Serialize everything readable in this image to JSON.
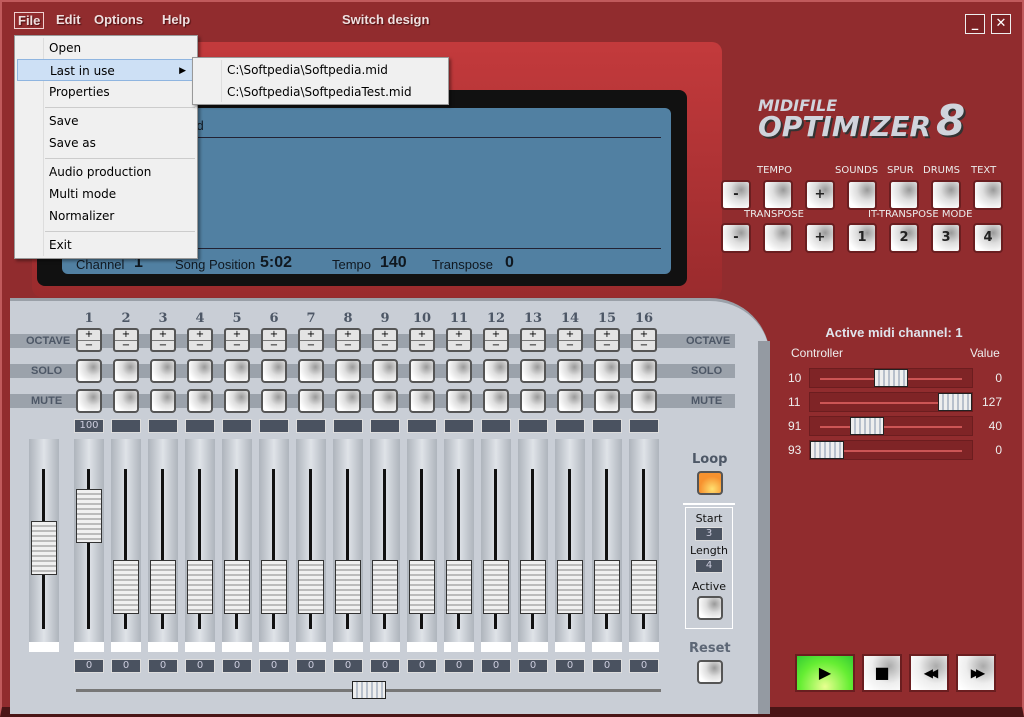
{
  "menu": {
    "file": "File",
    "edit": "Edit",
    "options": "Options",
    "help": "Help",
    "switch_design": "Switch design"
  },
  "window": {
    "minimize": "_",
    "close": "✕"
  },
  "file_menu": {
    "open": "Open",
    "last_in_use": "Last in use",
    "properties": "Properties",
    "save": "Save",
    "save_as": "Save as",
    "audio_production": "Audio production",
    "multi_mode": "Multi mode",
    "normalizer": "Normalizer",
    "exit": "Exit"
  },
  "recent_files": [
    "C:\\Softpedia\\Softpedia.mid",
    "C:\\Softpedia\\SoftpediaTest.mid"
  ],
  "display": {
    "filename": "a.mid",
    "channel_label": "Channel",
    "channel": "1",
    "song_position_label": "Song Position",
    "song_position": "5:02",
    "tempo_label": "Tempo",
    "tempo": "140",
    "transpose_label": "Transpose",
    "transpose": "0"
  },
  "logo": {
    "line1": "MIDIFILE",
    "line2": "OPTIMIZER",
    "version": "8"
  },
  "controls": {
    "tempo": "TEMPO",
    "sounds": "SOUNDS",
    "spur": "SPUR",
    "drums": "DRUMS",
    "text": "TEXT",
    "transpose": "TRANSPOSE",
    "it_transpose_mode": "IT-TRANSPOSE MODE",
    "minus": "-",
    "plus": "+",
    "modes": [
      "1",
      "2",
      "3",
      "4"
    ]
  },
  "mixer": {
    "octave": "OCTAVE",
    "solo": "SOLO",
    "mute": "MUTE",
    "plus": "+",
    "minus": "−",
    "channels": [
      {
        "n": "1",
        "top": "100",
        "bottom": "0",
        "level": 0.85
      },
      {
        "n": "2",
        "top": "",
        "bottom": "0",
        "level": 0.3
      },
      {
        "n": "3",
        "top": "",
        "bottom": "0",
        "level": 0.3
      },
      {
        "n": "4",
        "top": "",
        "bottom": "0",
        "level": 0.3
      },
      {
        "n": "5",
        "top": "",
        "bottom": "0",
        "level": 0.3
      },
      {
        "n": "6",
        "top": "",
        "bottom": "0",
        "level": 0.3
      },
      {
        "n": "7",
        "top": "",
        "bottom": "0",
        "level": 0.3
      },
      {
        "n": "8",
        "top": "",
        "bottom": "0",
        "level": 0.3
      },
      {
        "n": "9",
        "top": "",
        "bottom": "0",
        "level": 0.3
      },
      {
        "n": "10",
        "top": "",
        "bottom": "0",
        "level": 0.3
      },
      {
        "n": "11",
        "top": "",
        "bottom": "0",
        "level": 0.3
      },
      {
        "n": "12",
        "top": "",
        "bottom": "0",
        "level": 0.3
      },
      {
        "n": "13",
        "top": "",
        "bottom": "0",
        "level": 0.3
      },
      {
        "n": "14",
        "top": "",
        "bottom": "0",
        "level": 0.3
      },
      {
        "n": "15",
        "top": "",
        "bottom": "0",
        "level": 0.3
      },
      {
        "n": "16",
        "top": "",
        "bottom": "0",
        "level": 0.3
      }
    ],
    "master_level": 0.6,
    "pan": 0.5
  },
  "loop": {
    "label": "Loop",
    "start_label": "Start",
    "start": "3",
    "length_label": "Length",
    "length": "4",
    "active_label": "Active",
    "reset_label": "Reset"
  },
  "controllers": {
    "title": "Active midi channel: 1",
    "controller_header": "Controller",
    "value_header": "Value",
    "rows": [
      {
        "c": "10",
        "v": "0",
        "pos": 0.5
      },
      {
        "c": "11",
        "v": "127",
        "pos": 1.0
      },
      {
        "c": "91",
        "v": "40",
        "pos": 0.31
      },
      {
        "c": "93",
        "v": "0",
        "pos": 0.0
      }
    ]
  },
  "transport": {
    "play": "▶",
    "stop": "■",
    "rewind": "◀◀",
    "forward": "▶▶"
  },
  "colors": {
    "body": "#912c2e",
    "lcd": "#5180a2",
    "panel": "#c9ced6",
    "play": "#66ee33",
    "loop": "#f7922f"
  }
}
